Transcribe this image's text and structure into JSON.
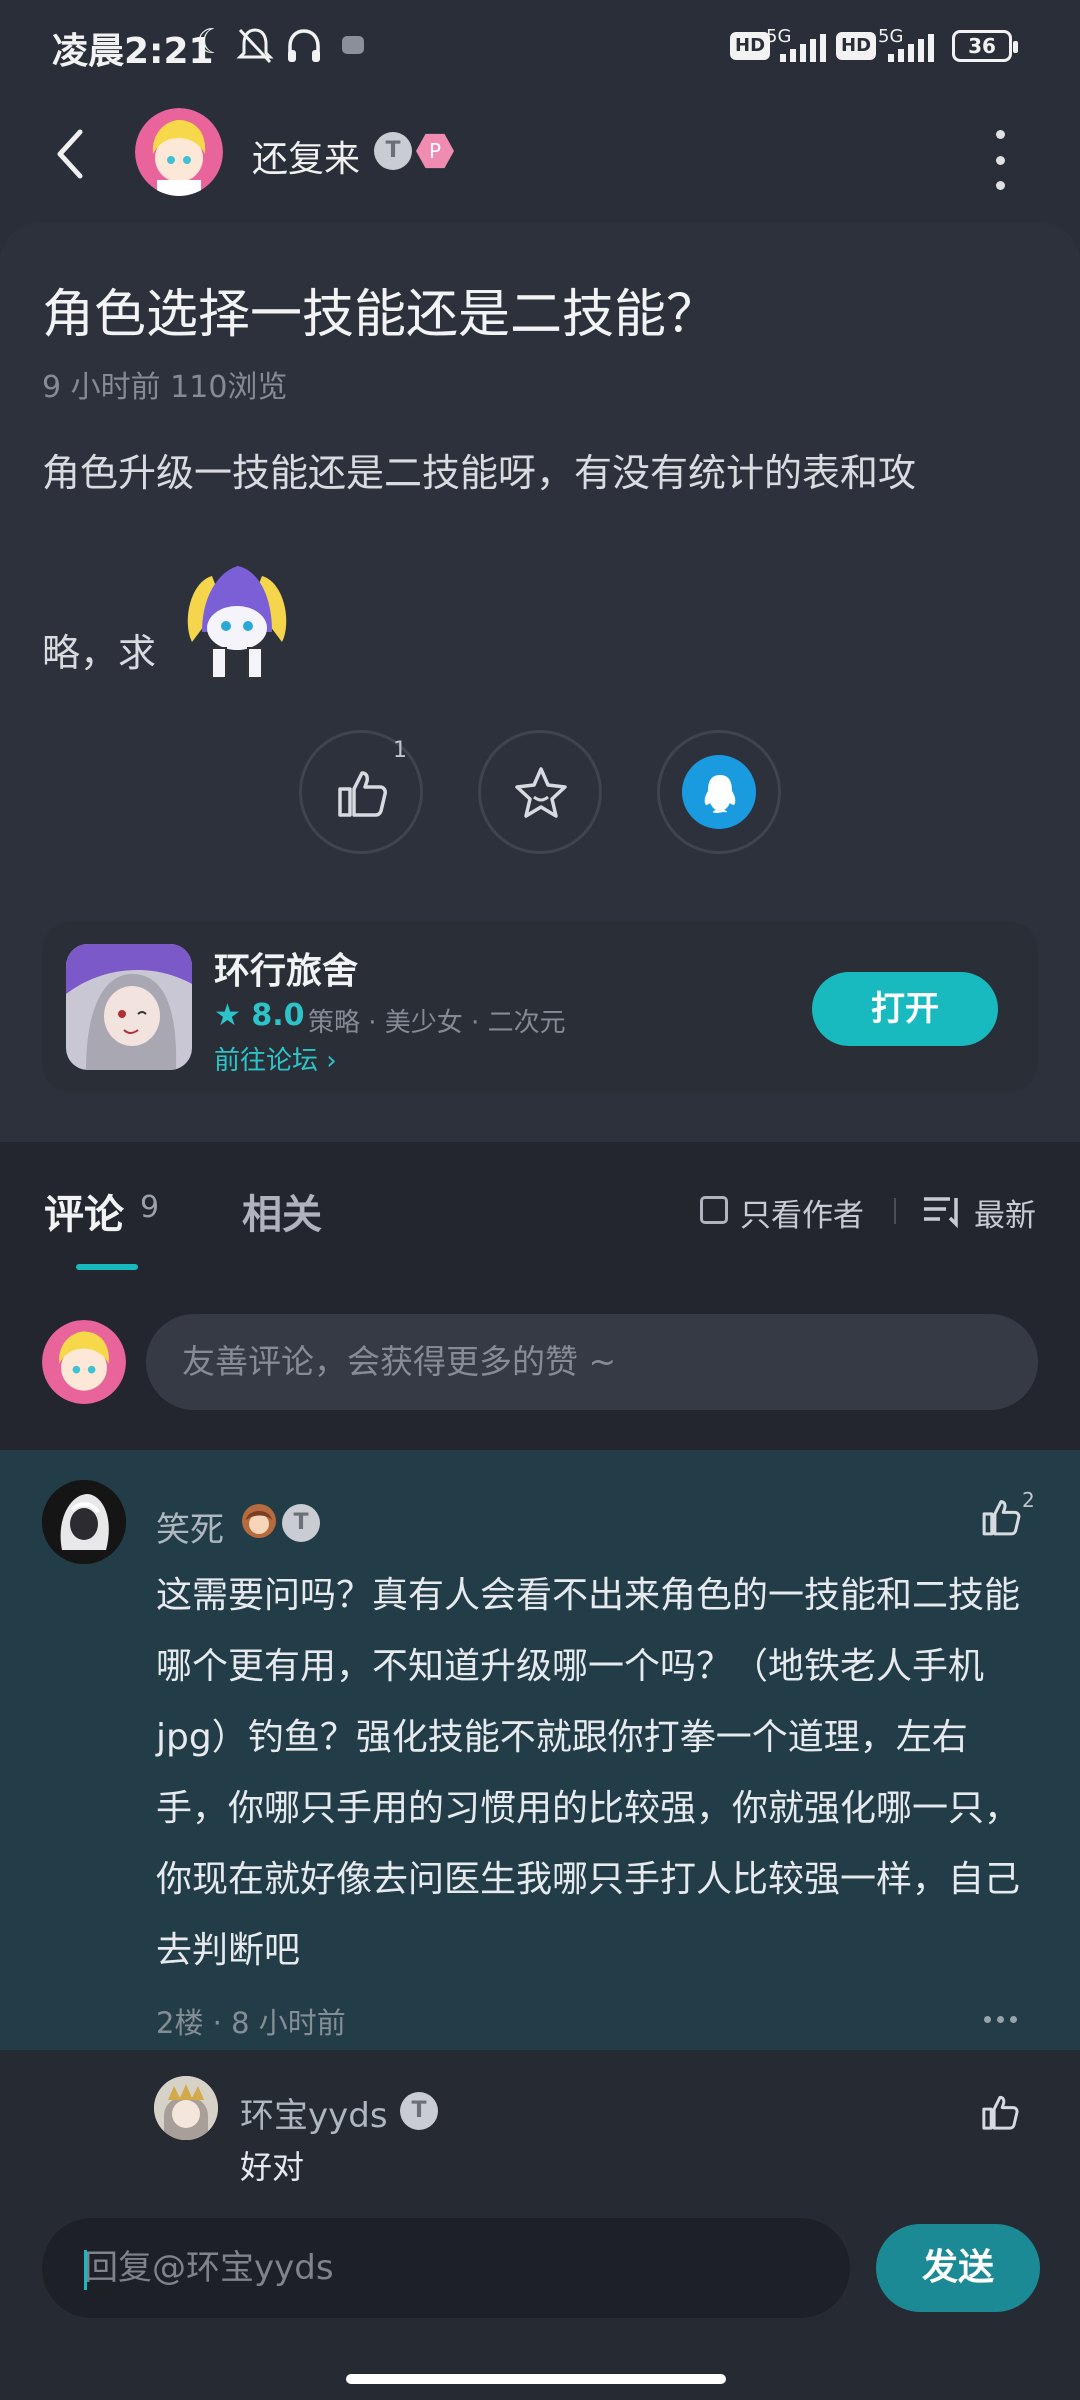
{
  "status_bar": {
    "time": "凌晨2:21",
    "hd1": "HD",
    "net1": "5G",
    "hd2": "HD",
    "net2": "5G",
    "battery": "36",
    "icons": [
      "moon-icon",
      "bell-off-icon",
      "headphones-icon",
      "app-notification-icon",
      "signal-icon",
      "battery-icon"
    ]
  },
  "header": {
    "author_name": "还复来",
    "badge_t": "T",
    "badge_level": "P",
    "icons": [
      "back-arrow-icon",
      "more-vertical-icon"
    ]
  },
  "post": {
    "title": "角色选择一技能还是二技能？",
    "meta": "9 小时前   110浏览",
    "body_line1": "角色升级一技能还是二技能呀，有没有统计的表和攻",
    "body_line2": "略，求",
    "like_count": "1",
    "actions": [
      "like-icon",
      "favorite-star-icon",
      "qq-share-icon"
    ]
  },
  "game_card": {
    "name": "环行旅舍",
    "score": "★ 8.0",
    "tags": "策略  ·  美少女  ·  二次元",
    "forum_link": "前往论坛 ›",
    "open_button": "打开"
  },
  "tabs": {
    "comment_label": "评论",
    "comment_count": "9",
    "related_label": "相关",
    "author_only": "只看作者",
    "sort_label": "最新"
  },
  "comment_input": {
    "placeholder": "友善评论，会获得更多的赞 ~"
  },
  "comment": {
    "user": "笑死",
    "like_count": "2",
    "text": "这需要问吗？真有人会看不出来角色的一技能和二技能哪个更有用，不知道升级哪一个吗？（地铁老人手机jpg）钓鱼？强化技能不就跟你打拳一个道理，左右手，你哪只手用的习惯用的比较强，你就强化哪一只，你现在就好像去问医生我哪只手打人比较强一样，自己去判断吧",
    "meta": "2楼 · 8 小时前"
  },
  "reply": {
    "user": "环宝yyds",
    "text": "好对"
  },
  "reply_bar": {
    "placeholder": "回复@环宝yyds",
    "send_button": "发送"
  },
  "colors": {
    "accent": "#18b9bf",
    "background": "#2a2e38",
    "highlight": "#223d47",
    "send": "#1b8a95"
  }
}
